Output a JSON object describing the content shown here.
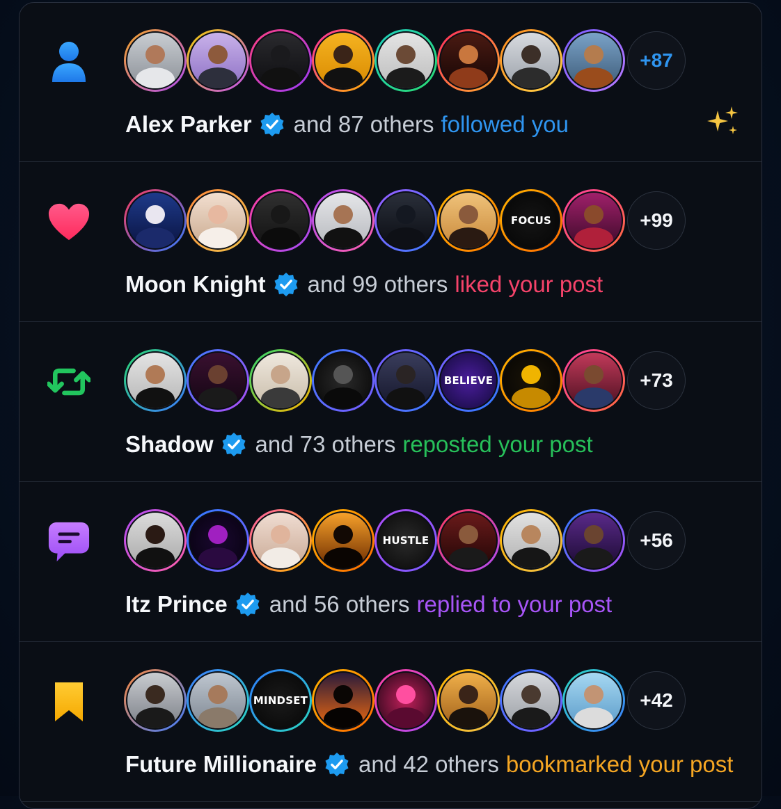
{
  "notifications": [
    {
      "type": "follow",
      "icon": "person-icon",
      "name": "Alex Parker",
      "rest": "and 87 others",
      "action": "followed you",
      "action_color": "#2f95f0",
      "count": "+87",
      "count_color": "#2f95f0",
      "sparkle": "sparkle-icon",
      "avatars": [
        {
          "ring": "linear-gradient(135deg,#f5a623,#b04cf5)",
          "bg": "linear-gradient(180deg,#c9cdd2,#8a8f96)",
          "skin": "#b0795a",
          "shirt": "#e6e7ea"
        },
        {
          "ring": "linear-gradient(135deg,#f2d000,#c04cf5)",
          "bg": "linear-gradient(180deg,#c9b2ea,#8c6fc4)",
          "skin": "#8d5a3c",
          "shirt": "#2d2f3c"
        },
        {
          "ring": "linear-gradient(135deg,#ff3f7f,#9b3cf7)",
          "bg": "linear-gradient(180deg,#2a2a2e,#0d0d10)",
          "skin": "#1a1a1d",
          "shirt": "#111"
        },
        {
          "ring": "linear-gradient(135deg,#ff2da0,#ffb400)",
          "bg": "linear-gradient(180deg,#f5b321,#d98a00)",
          "skin": "#3a2418",
          "shirt": "#111"
        },
        {
          "ring": "linear-gradient(135deg,#20d0c0,#2bd870)",
          "bg": "linear-gradient(180deg,#e4e4e4,#bcbcbc)",
          "skin": "#6b4a36",
          "shirt": "#1b1b1b"
        },
        {
          "ring": "linear-gradient(135deg,#ff2a5c,#ffb02e)",
          "bg": "linear-gradient(180deg,#4a1a12,#150605)",
          "skin": "#c9773e",
          "shirt": "#8f3b1a"
        },
        {
          "ring": "linear-gradient(135deg,#ff8a1e,#ffd54a)",
          "bg": "linear-gradient(180deg,#d8dbe0,#9aa0a8)",
          "skin": "#3c2f28",
          "shirt": "#2c2c2c"
        },
        {
          "ring": "linear-gradient(135deg,#7a5cff,#b87bff)",
          "bg": "linear-gradient(180deg,#7aa2c8,#3d5b78)",
          "skin": "#b47c4e",
          "shirt": "#9a4c1c"
        }
      ]
    },
    {
      "type": "like",
      "icon": "heart-icon",
      "name": "Moon Knight",
      "rest": "and 99 others",
      "action": "liked your post",
      "action_color": "#f5436a",
      "count": "+99",
      "count_color": "#f4f6f9",
      "avatars": [
        {
          "ring": "linear-gradient(135deg,#ff3a5c,#2f7bff)",
          "bg": "linear-gradient(180deg,#1e3a8a,#0a1340)",
          "skin": "#e9e6f0",
          "shirt": "#1b2a6b"
        },
        {
          "ring": "linear-gradient(135deg,#ff8a3c,#f0c14a)",
          "bg": "linear-gradient(180deg,#f2dfd0,#c9a98e)",
          "skin": "#e7b8a0",
          "shirt": "#f6efe9"
        },
        {
          "ring": "linear-gradient(135deg,#ff3fa0,#a34cf5)",
          "bg": "linear-gradient(180deg,#303030,#111)",
          "skin": "#181818",
          "shirt": "#0c0c0c"
        },
        {
          "ring": "linear-gradient(135deg,#b04cf5,#ff5fa8)",
          "bg": "linear-gradient(180deg,#e5e6e9,#b6b8bd)",
          "skin": "#a67454",
          "shirt": "#111"
        },
        {
          "ring": "linear-gradient(135deg,#9a5cff,#3c7bff)",
          "bg": "linear-gradient(180deg,#2a2f3a,#0a0c12)",
          "skin": "#141821",
          "shirt": "#0e1016"
        },
        {
          "ring": "linear-gradient(135deg,#ffb400,#ff7a00)",
          "bg": "linear-gradient(180deg,#efc27a,#c9893a)",
          "skin": "#8a5a3c",
          "shirt": "#2a1a12"
        },
        {
          "word": "FOCUS",
          "ring": "linear-gradient(135deg,#ffb400,#ff6a00)",
          "bg": "radial-gradient(circle,#141414,#050505)"
        },
        {
          "ring": "linear-gradient(135deg,#ff3fa0,#ff6a3c)",
          "bg": "linear-gradient(180deg,#a0206a,#3a0a28)",
          "skin": "#8a4a2c",
          "shirt": "#b0203a"
        }
      ]
    },
    {
      "type": "repost",
      "icon": "repost-icon",
      "name": "Shadow",
      "rest": "and 73 others",
      "action": "reposted your post",
      "action_color": "#27c05a",
      "count": "+73",
      "count_color": "#f4f6f9",
      "avatars": [
        {
          "ring": "linear-gradient(135deg,#2bd870,#3c7bff)",
          "bg": "linear-gradient(180deg,#e4e4e4,#b5b5b5)",
          "skin": "#b07a56",
          "shirt": "#111"
        },
        {
          "ring": "linear-gradient(135deg,#3c7bff,#b04cf5)",
          "bg": "linear-gradient(180deg,#3a1030,#120612)",
          "skin": "#6a4030",
          "shirt": "#1a1a1a"
        },
        {
          "ring": "linear-gradient(135deg,#2bd870,#ffb400)",
          "bg": "linear-gradient(180deg,#efe8de,#c8bca9)",
          "skin": "#c7a58a",
          "shirt": "#3a3a3a"
        },
        {
          "ring": "linear-gradient(135deg,#3c7bff,#7a5cff)",
          "bg": "radial-gradient(circle,#2a2a2a,#060606)",
          "skin": "#555",
          "shirt": "#0a0a0a"
        },
        {
          "ring": "linear-gradient(135deg,#7a5cff,#3c7bff)",
          "bg": "linear-gradient(180deg,#3a3d5c,#14162a)",
          "skin": "#2a2424",
          "shirt": "#111"
        },
        {
          "word": "BELIEVE",
          "ring": "linear-gradient(135deg,#7a5cff,#2f7bff)",
          "bg": "radial-gradient(circle,#4a1d9c,#120a3a)"
        },
        {
          "ring": "linear-gradient(135deg,#ffb400,#ff7a00)",
          "bg": "radial-gradient(circle,#1a1408,#050403)",
          "skin": "#f0b400",
          "shirt": "#c78a00"
        },
        {
          "ring": "linear-gradient(135deg,#ff3fa0,#ff6a3c)",
          "bg": "linear-gradient(180deg,#c23a5a,#4a1020)",
          "skin": "#7a4a30",
          "shirt": "#2a3a6a"
        }
      ]
    },
    {
      "type": "reply",
      "icon": "chat-bubble-icon",
      "name": "Itz Prince",
      "rest": "and 56 others",
      "action": "replied to your post",
      "action_color": "#a855f7",
      "count": "+56",
      "count_color": "#f4f6f9",
      "avatars": [
        {
          "ring": "linear-gradient(135deg,#b04cf5,#ff5fa8)",
          "bg": "linear-gradient(180deg,#dcdcdc,#a8a8a8)",
          "skin": "#2a1a14",
          "shirt": "#111"
        },
        {
          "ring": "linear-gradient(135deg,#2f7bff,#7a5cff)",
          "bg": "radial-gradient(circle,#1a0830,#06020e)",
          "skin": "#a020c0",
          "shirt": "#2a0a40"
        },
        {
          "ring": "linear-gradient(135deg,#ff5fa8,#ffb400)",
          "bg": "linear-gradient(180deg,#f0ddd2,#c8a894)",
          "skin": "#e0b49c",
          "shirt": "#f2ece6"
        },
        {
          "ring": "linear-gradient(135deg,#ffb400,#ff6a00)",
          "bg": "linear-gradient(180deg,#f7a12a,#6a2a00)",
          "skin": "#120904",
          "shirt": "#0a0502"
        },
        {
          "word": "HUSTLE",
          "ring": "linear-gradient(135deg,#b04cf5,#7a5cff)",
          "bg": "radial-gradient(circle,#2a2a2a,#080808)"
        },
        {
          "ring": "linear-gradient(135deg,#ff3a5c,#b04cf5)",
          "bg": "linear-gradient(180deg,#6a1a1a,#200606)",
          "skin": "#8a5a3c",
          "shirt": "#1a1a1a"
        },
        {
          "ring": "linear-gradient(135deg,#ffb400,#f0c14a)",
          "bg": "linear-gradient(180deg,#e2e2e2,#b0b0b0)",
          "skin": "#b8865e",
          "shirt": "#161616"
        },
        {
          "ring": "linear-gradient(135deg,#2f7bff,#b04cf5)",
          "bg": "linear-gradient(180deg,#5a2a8a,#1a0a30)",
          "skin": "#6a4430",
          "shirt": "#1a1a1a"
        }
      ]
    },
    {
      "type": "bookmark",
      "icon": "bookmark-icon",
      "name": "Future Millionaire",
      "rest": "and 42 others",
      "action": "bookmarked your post",
      "action_color": "#f5a623",
      "count": "+42",
      "count_color": "#f4f6f9",
      "avatars": [
        {
          "ring": "linear-gradient(135deg,#ff8a3c,#3c7bff)",
          "bg": "linear-gradient(180deg,#c9ccd0,#7a7e86)",
          "skin": "#3a2a20",
          "shirt": "#1a1a1a"
        },
        {
          "ring": "linear-gradient(135deg,#3c7bff,#2bd8c0)",
          "bg": "linear-gradient(180deg,#bfc7d0,#7c8590)",
          "skin": "#a67a5c",
          "shirt": "#8a7a6a"
        },
        {
          "word": "MINDSET",
          "ring": "linear-gradient(135deg,#2f7bff,#2bd8c0)",
          "bg": "radial-gradient(circle,#1a1a1a,#060606)"
        },
        {
          "ring": "linear-gradient(135deg,#ffb400,#ff6a00)",
          "bg": "linear-gradient(180deg,#2a1a3a,#f06a10)",
          "skin": "#0a0604",
          "shirt": "#060302"
        },
        {
          "ring": "linear-gradient(135deg,#ff3fa0,#b04cf5)",
          "bg": "radial-gradient(circle,#c0205a,#200616)",
          "skin": "#ff4fa0",
          "shirt": "#5a0a30"
        },
        {
          "ring": "linear-gradient(135deg,#ffb400,#f0c14a)",
          "bg": "linear-gradient(180deg,#f0b04a,#a0601a)",
          "skin": "#3a2418",
          "shirt": "#1a120c"
        },
        {
          "ring": "linear-gradient(135deg,#3c7bff,#7a5cff)",
          "bg": "linear-gradient(180deg,#d6d8dc,#9a9ea4)",
          "skin": "#4a3a30",
          "shirt": "#1a1a1a"
        },
        {
          "ring": "linear-gradient(135deg,#2bd8c0,#3c7bff)",
          "bg": "linear-gradient(180deg,#a6d8f2,#5a9ac8)",
          "skin": "#c29474",
          "shirt": "#dcdcdc"
        }
      ]
    }
  ]
}
